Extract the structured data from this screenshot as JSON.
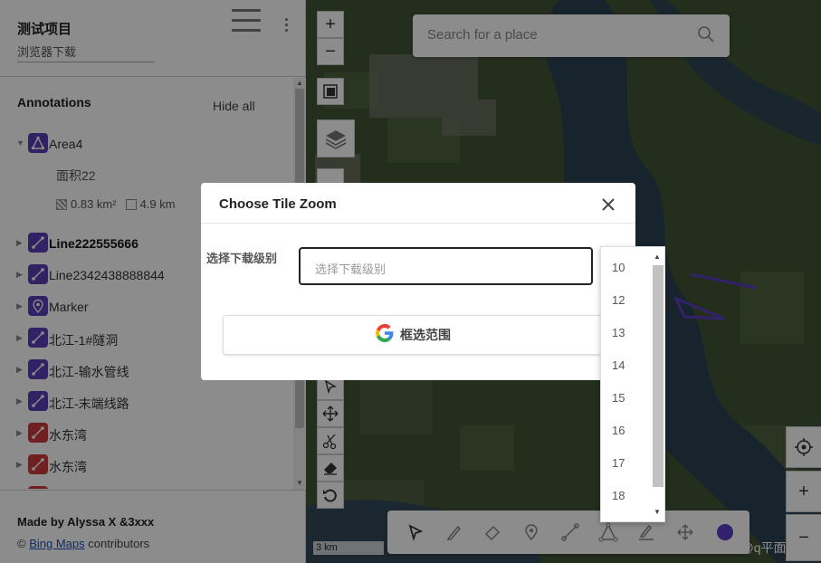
{
  "project": {
    "title": "测试项目",
    "subtitle": "浏览器下载"
  },
  "annotations": {
    "heading": "Annotations",
    "hide_all": "Hide all",
    "area_detail": {
      "name": "面积22",
      "area": "0.83 km²",
      "perimeter": "4.9 km"
    },
    "items": [
      {
        "label": "Area4",
        "type": "area",
        "color": "purple",
        "bold": false,
        "expanded": true
      },
      {
        "label": "Line222555666",
        "type": "line",
        "color": "purple",
        "bold": true
      },
      {
        "label": "Line2342438888844",
        "type": "line",
        "color": "purple",
        "bold": false
      },
      {
        "label": "Marker",
        "type": "marker",
        "color": "purple",
        "bold": false
      },
      {
        "label": "北江-1#隧洞",
        "type": "line",
        "color": "purple",
        "bold": false
      },
      {
        "label": "北江-输水管线",
        "type": "line",
        "color": "purple",
        "bold": false
      },
      {
        "label": "北江-末端线路",
        "type": "line",
        "color": "purple",
        "bold": false
      },
      {
        "label": "水东湾",
        "type": "line",
        "color": "red",
        "bold": false
      },
      {
        "label": "水东湾",
        "type": "line",
        "color": "red",
        "bold": false
      }
    ]
  },
  "footer": {
    "made_by": "Made by Alyssa X &3xxx",
    "copyright": "©",
    "link": "Bing Maps",
    "contributors": "contributors"
  },
  "search": {
    "placeholder": "Search for a place"
  },
  "map": {
    "scale_label": "3 km",
    "watermark": "CSDN @q平面人",
    "zoom_in": "+",
    "zoom_out": "−"
  },
  "dialog": {
    "title": "Choose Tile Zoom",
    "field_label": "选择下载级别",
    "select_placeholder": "选择下载级别",
    "button_label": "框选范围",
    "options": [
      "10",
      "12",
      "13",
      "14",
      "15",
      "16",
      "17",
      "18"
    ]
  },
  "colors": {
    "accent": "#5a3fb8",
    "danger": "#cc3b3b",
    "dot": "#5b3cc4"
  },
  "icons": [
    "menu-icon",
    "more-vertical-icon",
    "area-icon",
    "line-icon",
    "marker-icon",
    "search-icon",
    "close-icon",
    "google-logo-icon",
    "cursor-icon",
    "pencil-icon",
    "eraser-icon",
    "pin-icon",
    "move-icon",
    "scissors-icon",
    "undo-icon",
    "locate-icon",
    "layers-icon",
    "tile-icon"
  ]
}
